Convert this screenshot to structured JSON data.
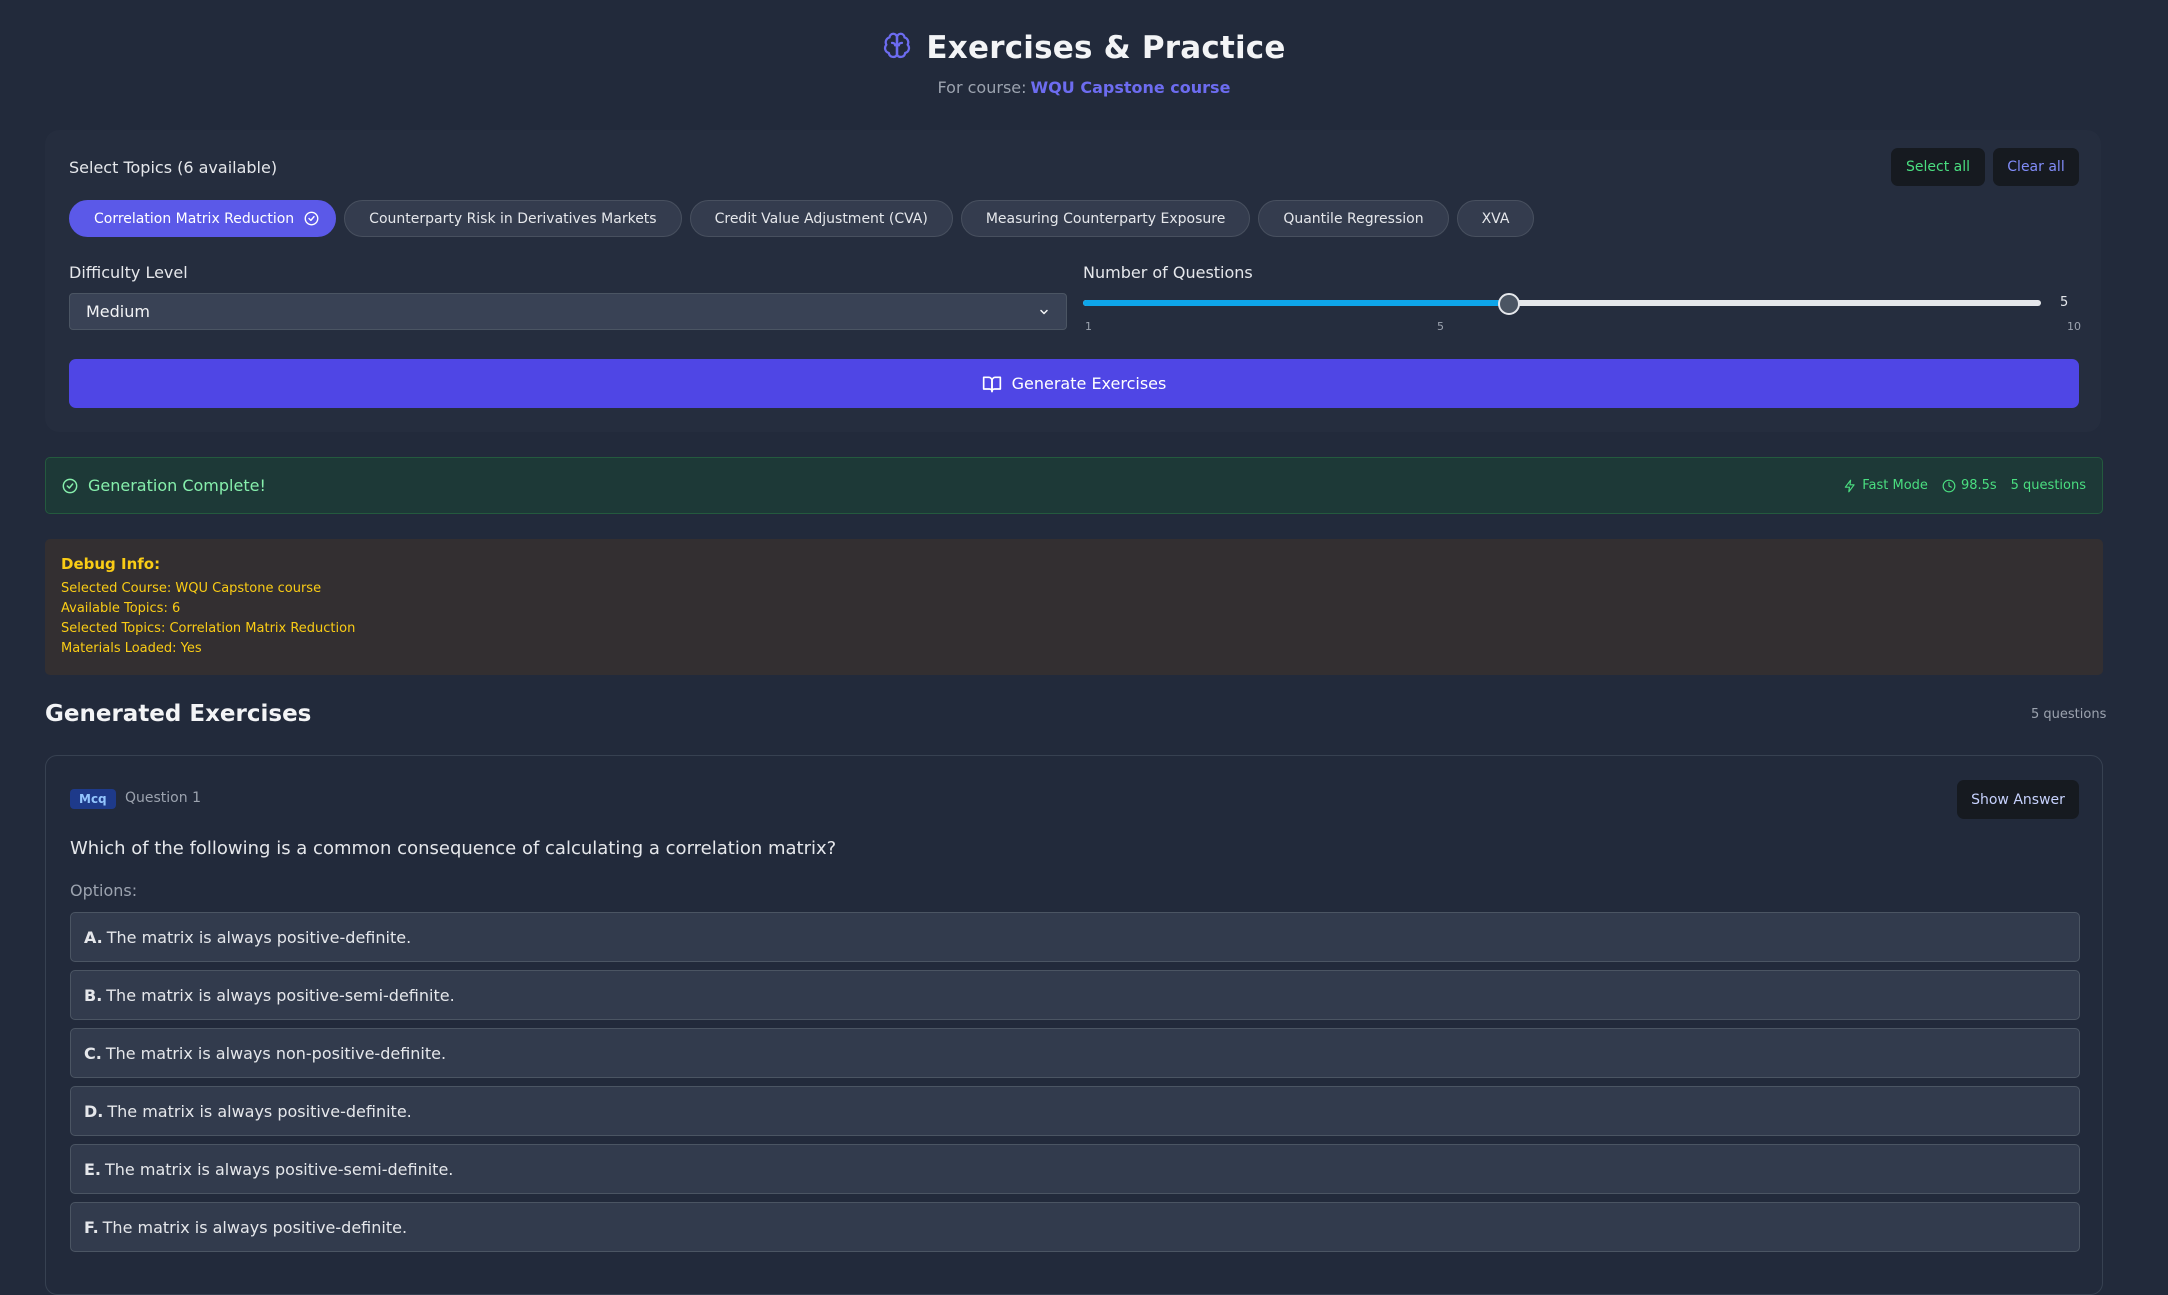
{
  "header": {
    "title": "Exercises & Practice",
    "subtitle_prefix": "For course:",
    "course": "WQU Capstone course"
  },
  "topics": {
    "label": "Select Topics (6 available)",
    "select_all": "Select all",
    "clear_all": "Clear all",
    "items": [
      {
        "label": "Correlation Matrix Reduction",
        "selected": true
      },
      {
        "label": "Counterparty Risk in Derivatives Markets",
        "selected": false
      },
      {
        "label": "Credit Value Adjustment (CVA)",
        "selected": false
      },
      {
        "label": "Measuring Counterparty Exposure",
        "selected": false
      },
      {
        "label": "Quantile Regression",
        "selected": false
      },
      {
        "label": "XVA",
        "selected": false
      }
    ]
  },
  "difficulty": {
    "label": "Difficulty Level",
    "value": "Medium"
  },
  "questions_slider": {
    "label": "Number of Questions",
    "value": 5,
    "min": 1,
    "max": 10,
    "ticks": [
      "1",
      "5",
      "10"
    ],
    "value_label": "5"
  },
  "generate_button": "Generate Exercises",
  "status": {
    "title": "Generation Complete!",
    "mode": "Fast Mode",
    "time": "98.5s",
    "count": "5 questions"
  },
  "debug": {
    "title": "Debug Info:",
    "lines": [
      "Selected Course: WQU Capstone course",
      "Available Topics: 6",
      "Selected Topics: Correlation Matrix Reduction",
      "Materials Loaded: Yes"
    ]
  },
  "exercises": {
    "title": "Generated Exercises",
    "count": "5 questions",
    "question": {
      "type": "Mcq",
      "number": "Question 1",
      "show_answer": "Show Answer",
      "text": "Which of the following is a common consequence of calculating a correlation matrix?",
      "options_label": "Options:",
      "options": [
        {
          "letter": "A.",
          "text": "The matrix is always positive-definite."
        },
        {
          "letter": "B.",
          "text": "The matrix is always positive-semi-definite."
        },
        {
          "letter": "C.",
          "text": "The matrix is always non-positive-definite."
        },
        {
          "letter": "D.",
          "text": "The matrix is always positive-definite."
        },
        {
          "letter": "E.",
          "text": "The matrix is always positive-semi-definite."
        },
        {
          "letter": "F.",
          "text": "The matrix is always positive-definite."
        }
      ]
    }
  },
  "colors": {
    "accent": "#4f46e5",
    "chip_active": "#5b59e8",
    "success": "#4ade80",
    "debug": "#facc15",
    "slider": "#0ea5e9"
  }
}
